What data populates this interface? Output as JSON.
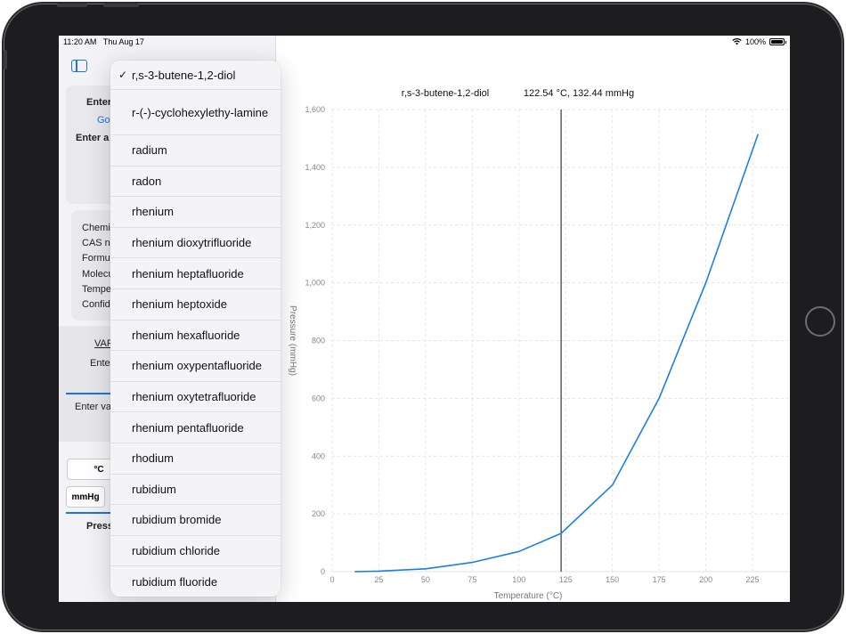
{
  "status": {
    "time": "11:20 AM",
    "date": "Thu Aug 17",
    "battery": "100%"
  },
  "sidebar": {
    "enter_heading": "Enter",
    "go_link": "Go",
    "enter_a": "Enter a",
    "info_labels": [
      "Chemi",
      "CAS nu",
      "Formu",
      "Molecu",
      "Tempe",
      "Confid"
    ],
    "vap_label": "VAP",
    "enter_field": "Enter",
    "enter_val": "Enter va",
    "temp_unit": "°C",
    "pressure_unit": "mmHg",
    "pressure_label": "Press"
  },
  "dropdown": {
    "selected_index": 0,
    "items": [
      "r,s-3-butene-1,2-diol",
      "r-(-)-cyclohexylethy-lamine",
      "radium",
      "radon",
      "rhenium",
      "rhenium dioxytrifluoride",
      "rhenium heptafluoride",
      "rhenium heptoxide",
      "rhenium hexafluoride",
      "rhenium oxypentafluoride",
      "rhenium oxytetrafluoride",
      "rhenium pentafluoride",
      "rhodium",
      "rubidium",
      "rubidium bromide",
      "rubidium chloride",
      "rubidium fluoride"
    ]
  },
  "chart_data": {
    "type": "line",
    "title": "r,s-3-butene-1,2-diol",
    "readout": "122.54 °C, 132.44 mmHg",
    "xlabel": "Temperature (°C)",
    "ylabel": "Pressure (mmHg)",
    "xlim": [
      0,
      245
    ],
    "ylim": [
      0,
      1600
    ],
    "xticks": [
      0,
      25,
      50,
      75,
      100,
      125,
      150,
      175,
      200,
      225
    ],
    "yticks": [
      0,
      200,
      400,
      600,
      800,
      1000,
      1200,
      1400,
      1600
    ],
    "ytick_labels": [
      "0",
      "200",
      "400",
      "600",
      "800",
      "1,000",
      "1,200",
      "1,400",
      "1,600"
    ],
    "cursor_x": 122.54,
    "grid": true,
    "line_color": "#1a7fe8",
    "series": [
      {
        "x": [
          12,
          25,
          50,
          75,
          100,
          122.54,
          150,
          175,
          200,
          228
        ],
        "y": [
          0,
          2,
          10,
          32,
          70,
          132.44,
          300,
          600,
          1000,
          1515
        ]
      }
    ]
  }
}
